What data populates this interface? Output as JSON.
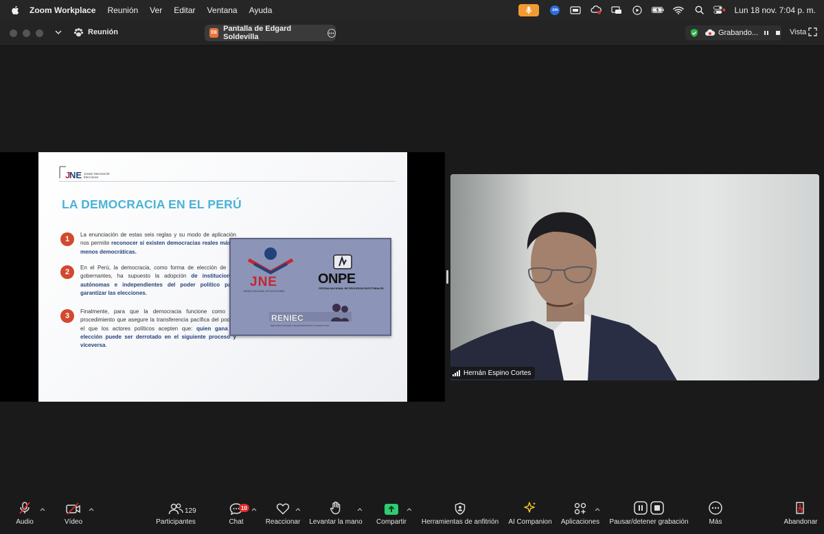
{
  "menubar": {
    "app_name": "Zoom Workplace",
    "menus": [
      "Reunión",
      "Ver",
      "Editar",
      "Ventana",
      "Ayuda"
    ],
    "datetime": "Lun 18 nov.  7:04 p. m.",
    "zm_label": "zm",
    "mic_color": "#f29b32"
  },
  "titlebar": {
    "meeting": "Reunión",
    "share_badge": "EB",
    "share_label": "Pantalla de Edgard Soldevilla",
    "recording_label": "Grabando...",
    "view_label": "Vista"
  },
  "slide": {
    "title": "LA DEMOCRACIA EN EL PERÚ",
    "logo_caption": "Jurado Nacional de Elecciones",
    "points": [
      {
        "num": "1",
        "text": "La enunciación de estas seis reglas y su modo de aplicación nos permite ",
        "bold": "reconocer si existen democracias reales más o menos democráticas."
      },
      {
        "num": "2",
        "text": "En el Perú, la democracia, como forma de elección de los gobernantes, ha supuesto la adopción ",
        "bold": "de instituciones autónomas e independientes del poder político para garantizar las elecciones."
      },
      {
        "num": "3",
        "text": "Finalmente, para que la democracia funcione como un procedimiento que asegure la transferencia pacífica del poder, el que los actores políticos acepten que: ",
        "bold": "quien gana la elección puede ser derrotado en el siguiente proceso y viceversa",
        "tail": "."
      }
    ],
    "logos": {
      "jne": "JNE",
      "jne_sub": "JURADO NACIONAL DE ELECCIONES",
      "onpe": "ONPE",
      "onpe_sub": "OFICINA NACIONAL DE PROCESOS ELECTORALES",
      "reniec": "RENIEC",
      "reniec_sub": "REGISTRO NACIONAL DE IDENTIFICACIÓN Y ESTADO CIVIL"
    },
    "title_color": "#4ab3d6",
    "number_color": "#d2492f"
  },
  "participant": {
    "name": "Hernán Espino Cortes"
  },
  "toolbar": {
    "audio": "Audio",
    "video": "Vídeo",
    "participants": "Participantes",
    "participants_count": "129",
    "chat": "Chat",
    "chat_badge": "10",
    "react": "Reaccionar",
    "raise_hand": "Levantar la mano",
    "share": "Compartir",
    "host_tools": "Herramientas de anfitrión",
    "ai_companion": "AI Companion",
    "apps": "Aplicaciones",
    "pause_recording": "Pausar/detener grabación",
    "more": "Más",
    "leave": "Abandonar",
    "share_color": "#2ecc71",
    "ai_color": "#f2c230",
    "leave_color": "#e02828"
  }
}
